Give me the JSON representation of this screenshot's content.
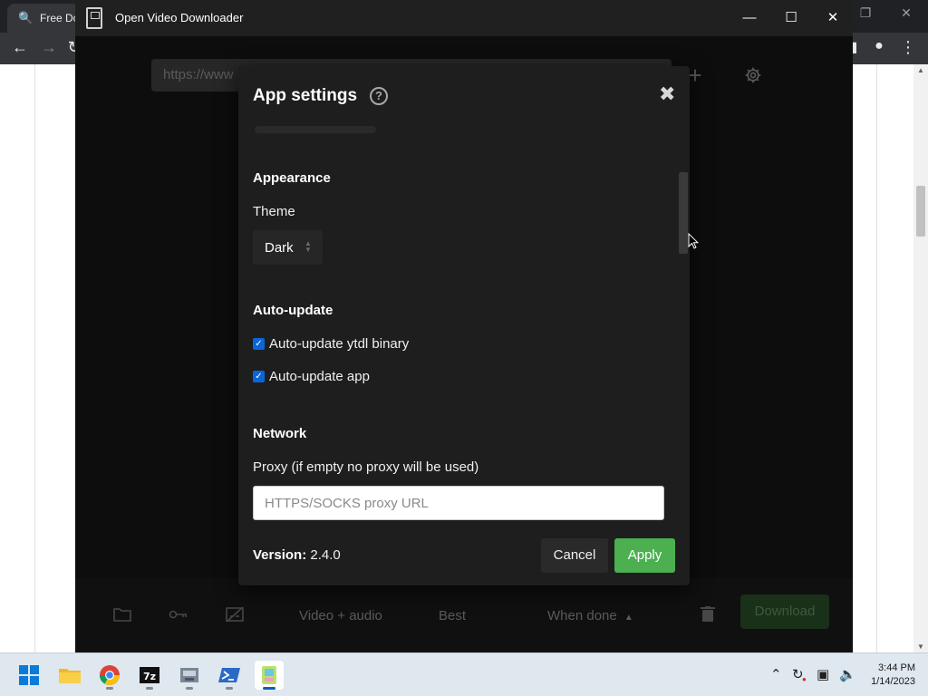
{
  "browser": {
    "tab_title": "Free Do",
    "tab_icon": "search-icon"
  },
  "app": {
    "window_title": "Open Video Downloader",
    "url_placeholder": "https://www",
    "add_label": "+",
    "bottom_bar": {
      "format": "Video + audio",
      "quality": "Best",
      "when_done": "When done",
      "download": "Download"
    }
  },
  "dialog": {
    "title": "App settings",
    "sections": {
      "appearance": {
        "heading": "Appearance",
        "theme_label": "Theme",
        "theme_value": "Dark"
      },
      "auto_update": {
        "heading": "Auto-update",
        "options": [
          {
            "label": "Auto-update ytdl binary",
            "checked": true
          },
          {
            "label": "Auto-update app",
            "checked": true
          }
        ]
      },
      "network": {
        "heading": "Network",
        "proxy_label": "Proxy (if empty no proxy will be used)",
        "proxy_placeholder": "HTTPS/SOCKS proxy URL",
        "proxy_value": ""
      }
    },
    "footer": {
      "version_label": "Version:",
      "version_value": "2.4.0",
      "cancel": "Cancel",
      "apply": "Apply"
    }
  },
  "taskbar": {
    "time": "3:44 PM",
    "date": "1/14/2023",
    "apps": [
      "start-icon",
      "file-explorer-icon",
      "chrome-icon",
      "7zip-icon",
      "installer-icon",
      "powershell-icon",
      "open-video-downloader-icon"
    ]
  },
  "colors": {
    "accent_apply": "#4caf50",
    "checkbox": "#0a66d8",
    "modal_bg": "#1e1e1e",
    "app_bg": "#151515"
  }
}
